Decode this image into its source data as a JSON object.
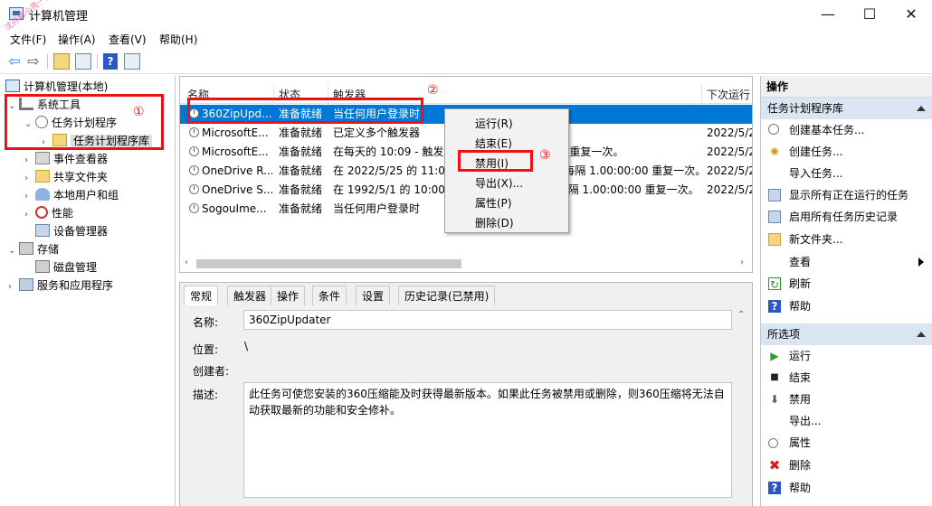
{
  "window": {
    "title": "计算机管理",
    "minimize_glyph": "—",
    "maximize_glyph": "☐",
    "close_glyph": "✕",
    "watermark": "沈孙数小亮一技术号"
  },
  "menu": {
    "file": "文件(F)",
    "action": "操作(A)",
    "view": "查看(V)",
    "help": "帮助(H)"
  },
  "toolbar": {
    "back_glyph": "⇦",
    "forward_glyph": "⇨",
    "help_glyph": "?"
  },
  "tree": {
    "root": "计算机管理(本地)",
    "system_tools": "系统工具",
    "task_scheduler": "任务计划程序",
    "task_scheduler_library": "任务计划程序库",
    "event_viewer": "事件查看器",
    "shared_folders": "共享文件夹",
    "local_users": "本地用户和组",
    "performance": "性能",
    "device_manager": "设备管理器",
    "storage": "存储",
    "disk_management": "磁盘管理",
    "services_apps": "服务和应用程序"
  },
  "list": {
    "headers": {
      "name": "名称",
      "status": "状态",
      "trigger": "触发器",
      "next_run": "下次运行"
    },
    "rows": [
      {
        "name": "360ZipUpd...",
        "status": "准备就绪",
        "trigger": "当任何用户登录时",
        "next_run": ""
      },
      {
        "name": "MicrosoftE...",
        "status": "准备就绪",
        "trigger": "已定义多个触发器",
        "next_run": "2022/5/2"
      },
      {
        "name": "MicrosoftE...",
        "status": "准备就绪",
        "trigger": "在每天的 10:09 - 触发后，无限期地每隔 1 小时 重复一次。",
        "next_run": "2022/5/2"
      },
      {
        "name": "OneDrive R...",
        "status": "准备就绪",
        "trigger": "在 2022/5/25 的 11:05 时 - 触发后，无限期地每隔 1.00:00:00 重复一次。",
        "next_run": "2022/5/2"
      },
      {
        "name": "OneDrive S...",
        "status": "准备就绪",
        "trigger": "在 1992/5/1 的 10:00 时 - 触发后，无限期地每隔 1.00:00:00 重复一次。",
        "next_run": "2022/5/2"
      },
      {
        "name": "SogouIme...",
        "status": "准备就绪",
        "trigger": "当任何用户登录时",
        "next_run": ""
      }
    ]
  },
  "context_menu": {
    "run": "运行(R)",
    "end": "结束(E)",
    "disable": "禁用(I)",
    "export": "导出(X)...",
    "properties": "属性(P)",
    "delete": "删除(D)"
  },
  "details": {
    "tabs": {
      "general": "常规",
      "triggers": "触发器",
      "actions": "操作",
      "conditions": "条件",
      "settings": "设置",
      "history": "历史记录(已禁用)"
    },
    "name_label": "名称:",
    "name_value": "360ZipUpdater",
    "location_label": "位置:",
    "location_value": "\\",
    "author_label": "创建者:",
    "description_label": "描述:",
    "description_value": "此任务可使您安装的360压缩能及时获得最新版本。如果此任务被禁用或删除，则360压缩将无法自动获取最新的功能和安全修补。"
  },
  "actions": {
    "title": "操作",
    "section1": "任务计划程序库",
    "items1": {
      "create_basic": "创建基本任务...",
      "create_task": "创建任务...",
      "import": "导入任务...",
      "show_running": "显示所有正在运行的任务",
      "enable_history": "启用所有任务历史记录",
      "new_folder": "新文件夹...",
      "view": "查看",
      "refresh": "刷新",
      "help": "帮助"
    },
    "section2": "所选项",
    "items2": {
      "run": "运行",
      "end": "结束",
      "disable": "禁用",
      "export": "导出...",
      "properties": "属性",
      "delete": "删除",
      "help": "帮助"
    }
  },
  "annotations": {
    "m1": "①",
    "m2": "②",
    "m3": "③"
  },
  "colors": {
    "selection": "#0078d7",
    "annotation": "#ee1111",
    "section_bg": "#d9e5f3"
  }
}
